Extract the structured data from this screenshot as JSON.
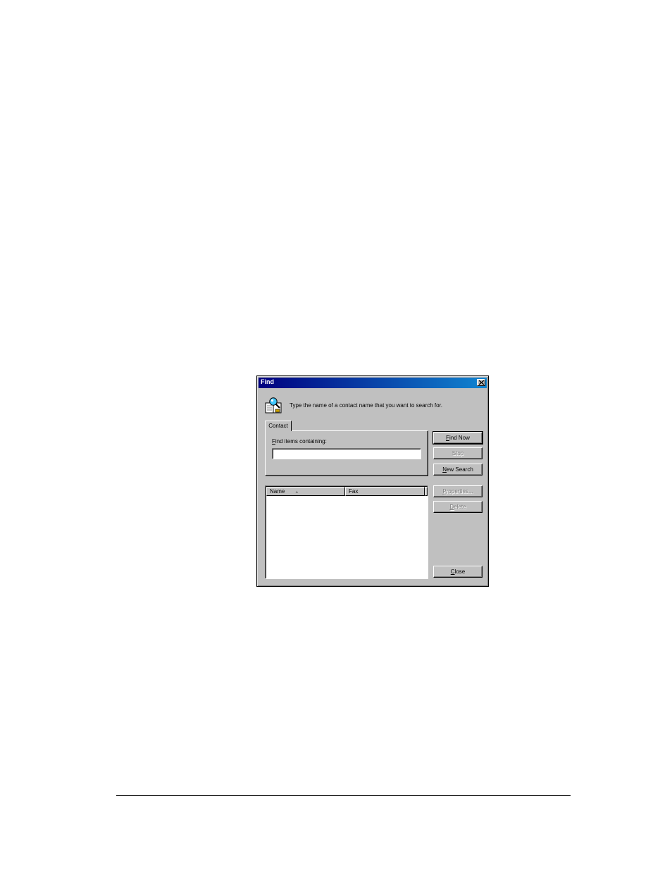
{
  "dialog": {
    "title": "Find",
    "prompt": "Type the name of a contact name that you want to search for.",
    "tab_label": "Contact",
    "field_label_access": "F",
    "field_label_rest": "ind items containing:",
    "find_input": {
      "value": "",
      "placeholder": ""
    },
    "buttons": {
      "find_now_access": "F",
      "find_now_rest": "ind Now",
      "stop": "Stop",
      "new_search_access": "N",
      "new_search_rest": "ew Search",
      "properties_access": "P",
      "properties_rest": "roperties...",
      "delete_access": "D",
      "delete_rest": "elete",
      "close_access": "C",
      "close_rest": "lose"
    },
    "columns": [
      "Name",
      "Fax"
    ],
    "rows": []
  }
}
